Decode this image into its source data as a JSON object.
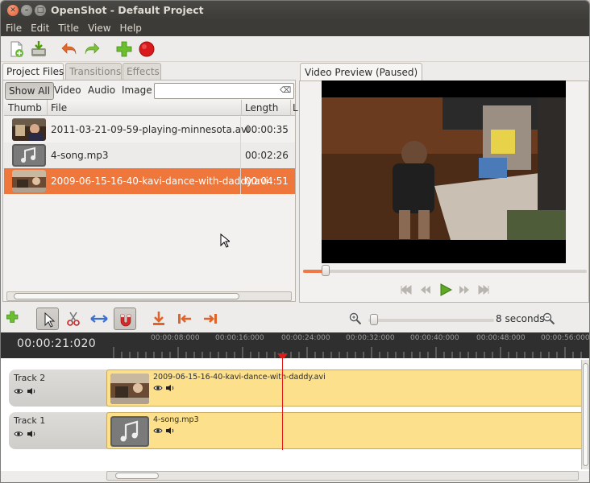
{
  "window": {
    "title": "OpenShot - Default Project"
  },
  "menu": [
    "File",
    "Edit",
    "Title",
    "View",
    "Help"
  ],
  "toolbar_icons": [
    "new-file-icon",
    "save-icon",
    "undo-icon",
    "redo-icon",
    "add-icon",
    "record-icon"
  ],
  "left_tabs": [
    "Project Files",
    "Transitions",
    "Effects"
  ],
  "filters": [
    "Show All",
    "Video",
    "Audio",
    "Image"
  ],
  "search": {
    "placeholder": "",
    "value": ""
  },
  "table": {
    "columns": [
      "Thumb",
      "File",
      "Length",
      "L"
    ],
    "rows": [
      {
        "file": "2011-03-21-09-59-playing-minnesota.avi",
        "length": "00:00:35",
        "thumb": "video",
        "selected": false
      },
      {
        "file": "4-song.mp3",
        "length": "00:02:26",
        "thumb": "audio",
        "selected": false
      },
      {
        "file": "2009-06-15-16-40-kavi-dance-with-daddy.avi",
        "length": "00:04:51",
        "thumb": "video",
        "selected": true
      }
    ]
  },
  "preview": {
    "tab": "Video Preview (Paused)",
    "progress": 0.08
  },
  "playback_icons": [
    "skip-start-icon",
    "rewind-icon",
    "play-icon",
    "fast-forward-icon",
    "skip-end-icon"
  ],
  "timeline": {
    "timecode": "00:00:21:020",
    "zoom_label": "8 seconds",
    "ruler_labels": [
      "00:00:08:000",
      "00:00:16:000",
      "00:00:24:000",
      "00:00:32:000",
      "00:00:40:000",
      "00:00:48:000",
      "00:00:56:000"
    ],
    "tracks": [
      {
        "name": "Track 2",
        "clip": "2009-06-15-16-40-kavi-dance-with-daddy.avi",
        "type": "video"
      },
      {
        "name": "Track 1",
        "clip": "4-song.mp3",
        "type": "audio"
      }
    ]
  },
  "colors": {
    "selection": "#f0773b",
    "clip": "#fde08c",
    "titlebar": "#3c3b37",
    "playhead": "#e01919"
  }
}
